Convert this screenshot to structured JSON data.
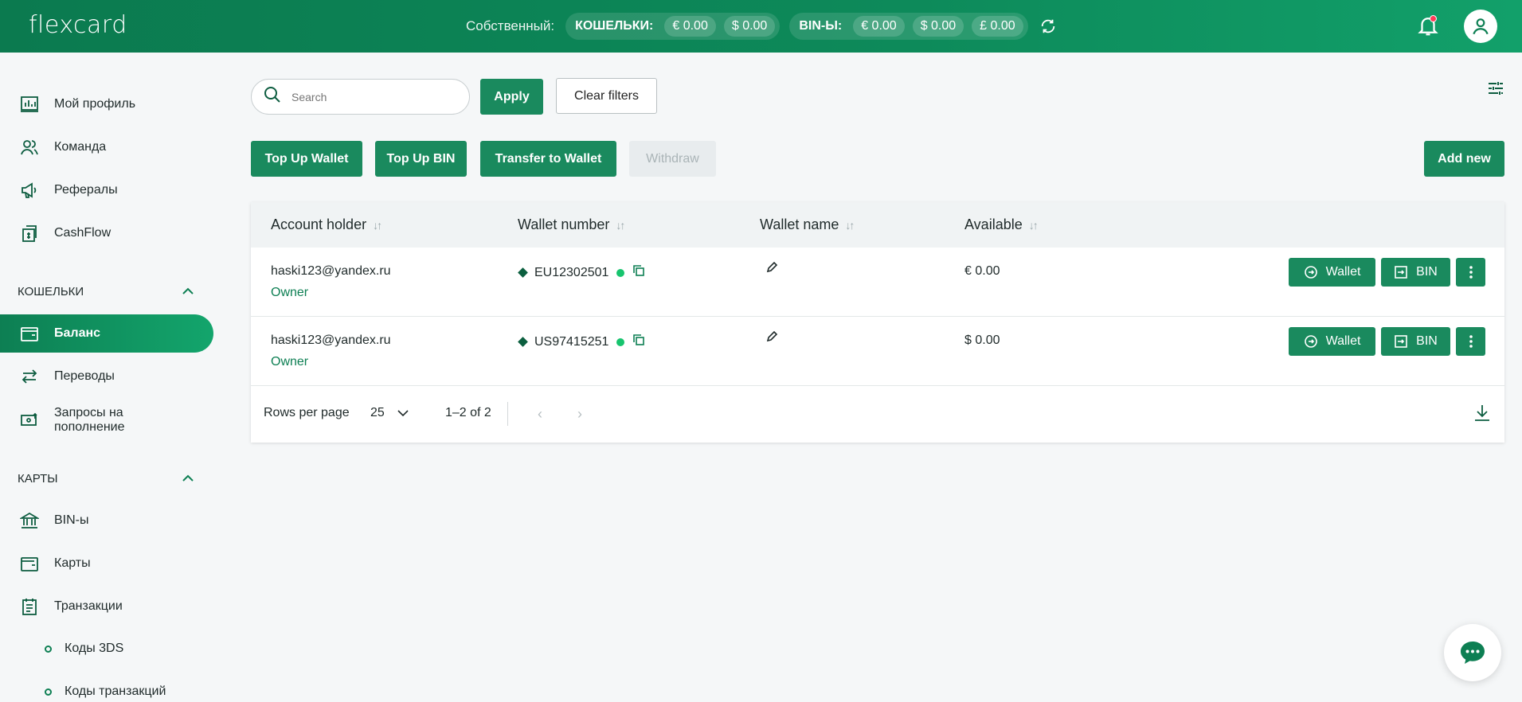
{
  "header": {
    "logo": "flexcard",
    "own_label": "Собственный:",
    "wallets_label": "КОШЕЛЬКИ:",
    "wallet_balances": [
      "€ 0.00",
      "$ 0.00"
    ],
    "bins_label": "BIN-Ы:",
    "bin_balances": [
      "€ 0.00",
      "$ 0.00",
      "£ 0.00"
    ]
  },
  "sidebar": {
    "items": [
      {
        "label": "Мой профиль",
        "icon": "profile-chart-icon"
      },
      {
        "label": "Команда",
        "icon": "team-icon"
      },
      {
        "label": "Рефералы",
        "icon": "megaphone-icon"
      },
      {
        "label": "CashFlow",
        "icon": "cashflow-icon"
      }
    ],
    "wallets_section": "КОШЕЛЬКИ",
    "wallet_items": [
      {
        "label": "Баланс",
        "icon": "wallet-icon",
        "active": true
      },
      {
        "label": "Переводы",
        "icon": "transfer-arrows-icon"
      },
      {
        "label": "Запросы на пополнение",
        "icon": "money-request-icon"
      }
    ],
    "cards_section": "КАРТЫ",
    "card_items": [
      {
        "label": "BIN-ы",
        "icon": "bank-icon"
      },
      {
        "label": "Карты",
        "icon": "card-wallet-icon"
      },
      {
        "label": "Транзакции",
        "icon": "transactions-icon"
      }
    ],
    "sub_items": [
      "Коды 3DS",
      "Коды транзакций"
    ]
  },
  "toolbar": {
    "search_placeholder": "Search",
    "apply": "Apply",
    "clear_filters": "Clear filters",
    "top_up_wallet": "Top Up Wallet",
    "top_up_bin": "Top Up BIN",
    "transfer_to_wallet": "Transfer to Wallet",
    "withdraw": "Withdraw",
    "add_new": "Add new"
  },
  "table": {
    "columns": [
      "Account holder",
      "Wallet number",
      "Wallet name",
      "Available"
    ],
    "rows": [
      {
        "email": "haski123@yandex.ru",
        "role": "Owner",
        "wallet_number": "EU12302501",
        "available": "€ 0.00",
        "wallet_btn": "Wallet",
        "bin_btn": "BIN"
      },
      {
        "email": "haski123@yandex.ru",
        "role": "Owner",
        "wallet_number": "US97415251",
        "available": "$ 0.00",
        "wallet_btn": "Wallet",
        "bin_btn": "BIN"
      }
    ],
    "rows_per_page_label": "Rows per page",
    "rows_per_page_value": "25",
    "range_text": "1–2 of 2"
  },
  "colors": {
    "brand": "#0d8a5a",
    "button": "#1a8a5e",
    "status": "#17c46e"
  }
}
